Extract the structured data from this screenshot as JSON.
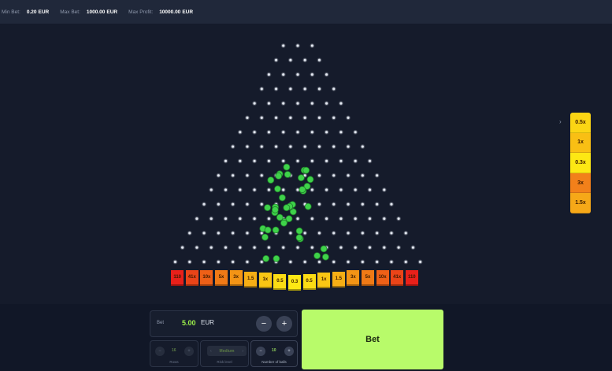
{
  "limits": {
    "min_bet_label": "Min Bet:",
    "min_bet_value": "0.20",
    "max_bet_label": "Max Bet:",
    "max_bet_value": "1000.00",
    "max_profit_label": "Max Profit:",
    "max_profit_value": "10000.00",
    "currency": "EUR"
  },
  "board": {
    "top_pins": 3,
    "rows": 16,
    "ball_color": "#3fd24a",
    "balls_in_play": 40
  },
  "multipliers": [
    "110",
    "41x",
    "10x",
    "5x",
    "3x",
    "1.5",
    "1x",
    "0.5",
    "0.3",
    "0.5",
    "1x",
    "1.5",
    "3x",
    "5x",
    "10x",
    "41x",
    "110"
  ],
  "multiplier_colors": [
    "#e8201a",
    "#ea4418",
    "#ee6017",
    "#f07a16",
    "#f39415",
    "#f6ae15",
    "#f9c614",
    "#fbdc14",
    "#fde814",
    "#fbdc14",
    "#f9c614",
    "#f6ae15",
    "#f39415",
    "#f07a16",
    "#ee6017",
    "#ea4418",
    "#e8201a"
  ],
  "history": [
    {
      "label": "0.5x",
      "color": "#fbd514"
    },
    {
      "label": "1x",
      "color": "#f9bf14"
    },
    {
      "label": "0.3x",
      "color": "#fde814"
    },
    {
      "label": "3x",
      "color": "#f2801a"
    },
    {
      "label": "1.5x",
      "color": "#f6a818"
    }
  ],
  "bet": {
    "label": "Bet",
    "amount": "5.00",
    "currency": "EUR",
    "minus": "−",
    "plus": "+"
  },
  "rows_control": {
    "value": "16",
    "caption": "Rows",
    "minus": "−",
    "plus": "+"
  },
  "risk_control": {
    "value": "Medium",
    "caption": "Risk level",
    "left": "‹",
    "right": "›"
  },
  "balls_control": {
    "value": "10",
    "caption": "Number of balls",
    "minus": "−",
    "plus": "+"
  },
  "bet_button_label": "Bet"
}
